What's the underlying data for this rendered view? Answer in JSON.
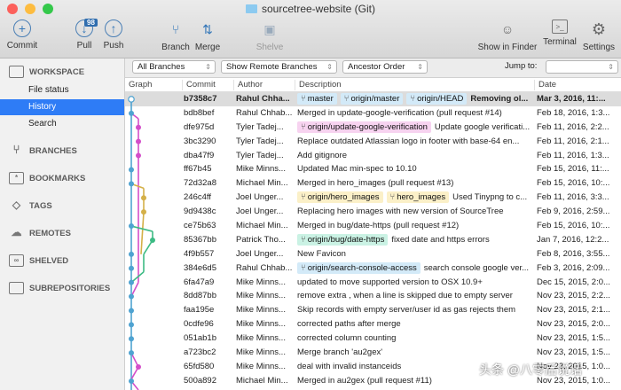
{
  "window": {
    "title": "sourcetree-website (Git)"
  },
  "toolbar": {
    "commit": "Commit",
    "pull": "Pull",
    "pull_badge": "98",
    "push": "Push",
    "branch": "Branch",
    "merge": "Merge",
    "shelve": "Shelve",
    "show_in_finder": "Show in Finder",
    "terminal": "Terminal",
    "settings": "Settings"
  },
  "sidebar": {
    "workspace": "WORKSPACE",
    "file_status": "File status",
    "history": "History",
    "search": "Search",
    "branches": "BRANCHES",
    "bookmarks": "BOOKMARKS",
    "tags": "TAGS",
    "remotes": "REMOTES",
    "shelved": "SHELVED",
    "subrepositories": "SUBREPOSITORIES"
  },
  "filters": {
    "branches": "All Branches",
    "remote": "Show Remote Branches",
    "order": "Ancestor Order",
    "jump_label": "Jump to:",
    "jump_value": ""
  },
  "columns": {
    "graph": "Graph",
    "commit": "Commit",
    "author": "Author",
    "description": "Description",
    "date": "Date"
  },
  "ref_colors": {
    "blue": "#d3eaf8",
    "pink": "#f7d3f0",
    "yellow": "#fbf0c8",
    "green": "#caf2e4"
  },
  "commits": [
    {
      "hash": "b7358c7",
      "author": "Rahul Chha...",
      "refs": [
        {
          "name": "master",
          "color": "blue"
        },
        {
          "name": "origin/master",
          "color": "blue"
        },
        {
          "name": "origin/HEAD",
          "color": "blue"
        }
      ],
      "message": "Removing ol...",
      "date": "Mar 3, 2016, 11:..."
    },
    {
      "hash": "bdb8bef",
      "author": "Rahul Chhab...",
      "refs": [],
      "message": "Merged in update-google-verification (pull request #14)",
      "date": "Feb 18, 2016, 1:3..."
    },
    {
      "hash": "dfe975d",
      "author": "Tyler Tadej...",
      "refs": [
        {
          "name": "origin/update-google-verification",
          "color": "pink"
        }
      ],
      "message": "Update google verificati...",
      "date": "Feb 11, 2016, 2:2..."
    },
    {
      "hash": "3bc3290",
      "author": "Tyler Tadej...",
      "refs": [],
      "message": "Replace outdated Atlassian logo in footer with base-64 en...",
      "date": "Feb 11, 2016, 2:1..."
    },
    {
      "hash": "dba47f9",
      "author": "Tyler Tadej...",
      "refs": [],
      "message": "Add gitignore",
      "date": "Feb 11, 2016, 1:3..."
    },
    {
      "hash": "ff67b45",
      "author": "Mike Minns...",
      "refs": [],
      "message": "Updated Mac min-spec to 10.10",
      "date": "Feb 15, 2016, 11:..."
    },
    {
      "hash": "72d32a8",
      "author": "Michael Min...",
      "refs": [],
      "message": "Merged in hero_images (pull request #13)",
      "date": "Feb 15, 2016, 10:..."
    },
    {
      "hash": "246c4ff",
      "author": "Joel Unger...",
      "refs": [
        {
          "name": "origin/hero_images",
          "color": "yellow"
        },
        {
          "name": "hero_images",
          "color": "yellow"
        }
      ],
      "message": "Used Tinypng to c...",
      "date": "Feb 11, 2016, 3:3..."
    },
    {
      "hash": "9d9438c",
      "author": "Joel Unger...",
      "refs": [],
      "message": "Replacing hero images with new version of SourceTree",
      "date": "Feb 9, 2016, 2:59..."
    },
    {
      "hash": "ce75b63",
      "author": "Michael Min...",
      "refs": [],
      "message": "Merged in bug/date-https (pull request #12)",
      "date": "Feb 15, 2016, 10:..."
    },
    {
      "hash": "85367bb",
      "author": "Patrick Tho...",
      "refs": [
        {
          "name": "origin/bug/date-https",
          "color": "green"
        }
      ],
      "message": "fixed date and https errors",
      "date": "Jan 7, 2016, 12:2..."
    },
    {
      "hash": "4f9b557",
      "author": "Joel Unger...",
      "refs": [],
      "message": "New Favicon",
      "date": "Feb 8, 2016, 3:55..."
    },
    {
      "hash": "384e6d5",
      "author": "Rahul Chhab...",
      "refs": [
        {
          "name": "origin/search-console-access",
          "color": "blue"
        }
      ],
      "message": "search console google ver...",
      "date": "Feb 3, 2016, 2:09..."
    },
    {
      "hash": "6fa47a9",
      "author": "Mike Minns...",
      "refs": [],
      "message": "updated to move supported version to OSX 10.9+",
      "date": "Dec 15, 2015, 2:0..."
    },
    {
      "hash": "8dd87bb",
      "author": "Mike Minns...",
      "refs": [],
      "message": "remove extra , when a line is skipped due to empty server",
      "date": "Nov 23, 2015, 2:2..."
    },
    {
      "hash": "faa195e",
      "author": "Mike Minns...",
      "refs": [],
      "message": "Skip records with empty server/user id as gas rejects them",
      "date": "Nov 23, 2015, 2:1..."
    },
    {
      "hash": "0cdfe96",
      "author": "Mike Minns...",
      "refs": [],
      "message": "corrected paths after merge",
      "date": "Nov 23, 2015, 2:0..."
    },
    {
      "hash": "051ab1b",
      "author": "Mike Minns...",
      "refs": [],
      "message": " corrected column counting",
      "date": "Nov 23, 2015, 1:5..."
    },
    {
      "hash": "a723bc2",
      "author": "Mike Minns...",
      "refs": [],
      "message": "Merge branch 'au2gex'",
      "date": "Nov 23, 2015, 1:5..."
    },
    {
      "hash": "65fd580",
      "author": "Mike Minns...",
      "refs": [],
      "message": "deal with invalid instanceids",
      "date": "Nov 23, 2015, 1:0..."
    },
    {
      "hash": "500a892",
      "author": "Michael Min...",
      "refs": [],
      "message": "Merged in au2gex (pull request #11)",
      "date": "Nov 23, 2015, 1:0..."
    }
  ],
  "watermark": "头条 @八零后说话"
}
